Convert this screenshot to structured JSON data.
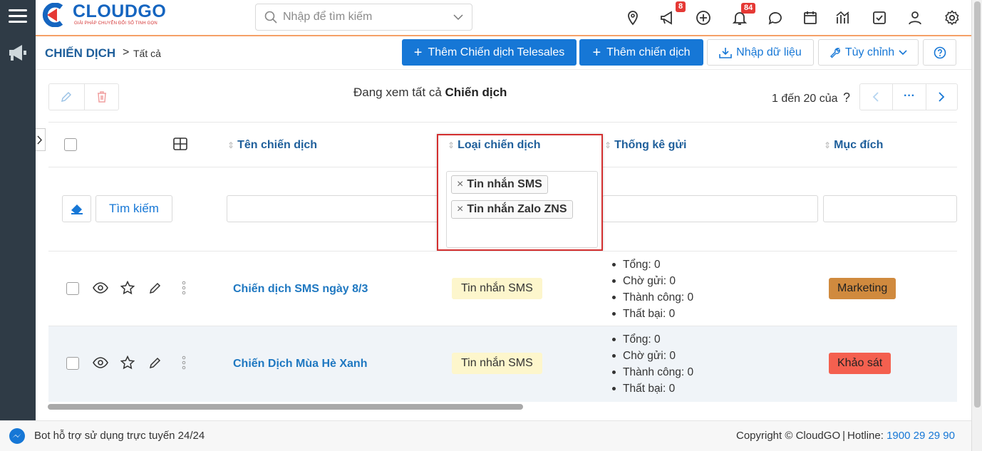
{
  "brand": {
    "name": "CLOUDGO",
    "tagline": "GIẢI PHÁP CHUYỂN ĐỔI SỐ TINH GỌN"
  },
  "search": {
    "placeholder": "Nhập để tìm kiếm"
  },
  "badges": {
    "campaign": "8",
    "notifications": "84"
  },
  "breadcrumb": {
    "module": "CHIẾN DỊCH",
    "separator": ">",
    "current": "Tất cả"
  },
  "toolbar": {
    "add_telesales": "Thêm Chiến dịch Telesales",
    "add_campaign": "Thêm chiến dịch",
    "import": "Nhập dữ liệu",
    "customize": "Tùy chỉnh"
  },
  "listview": {
    "viewing_prefix": "Đang xem tất cả",
    "viewing_module": "Chiến dịch",
    "pagination": "1 đến 20 của",
    "total_unknown": "?",
    "more": "···"
  },
  "columns": {
    "name": "Tên chiến dịch",
    "type": "Loại chiến dịch",
    "stats": "Thống kê gửi",
    "purpose": "Mục đích"
  },
  "filter": {
    "search_button": "Tìm kiếm",
    "type_chips": [
      "Tin nhắn SMS",
      "Tin nhắn Zalo ZNS"
    ]
  },
  "rows": [
    {
      "name": "Chiến dịch SMS ngày 8/3",
      "type": "Tin nhắn SMS",
      "stats": [
        "Tổng: 0",
        "Chờ gửi: 0",
        "Thành công: 0",
        "Thất bại: 0"
      ],
      "purpose": "Marketing",
      "purpose_color": "#d08a3e"
    },
    {
      "name": "Chiến Dịch Mùa Hè Xanh",
      "type": "Tin nhắn SMS",
      "stats": [
        "Tổng: 0",
        "Chờ gửi: 0",
        "Thành công: 0",
        "Thất bại: 0"
      ],
      "purpose": "Khảo sát",
      "purpose_color": "#f4604f"
    }
  ],
  "footer": {
    "bot": "Bot hỗ trợ sử dụng trực tuyến 24/24",
    "copyright": "Copyright © CloudGO",
    "hotline_label": "Hotline:",
    "hotline": "1900 29 29 90"
  },
  "colors": {
    "primary": "#1677d6",
    "sidebar": "#2f3b46",
    "highlight": "#d32f2f"
  }
}
